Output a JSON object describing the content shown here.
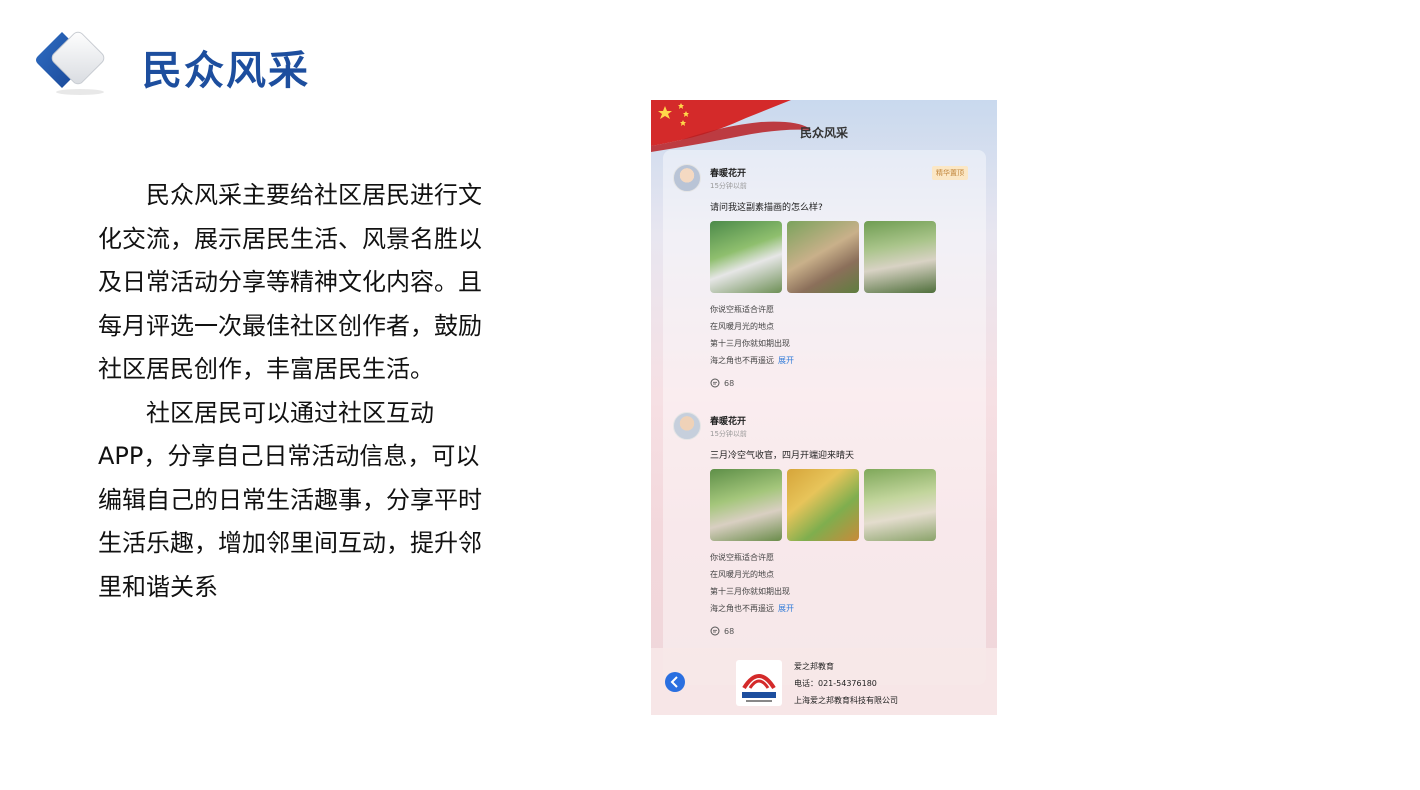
{
  "header": {
    "title": "民众风采"
  },
  "description": {
    "paragraphs": [
      "民众风采主要给社区居民进行文化交流，展示居民生活、风景名胜以及日常活动分享等精神文化内容。且每月评选一次最佳社区创作者，鼓励社区居民创作，丰富居民生活。",
      "社区居民可以通过社区互动APP，分享自己日常活动信息，可以编辑自己的日常生活趣事，分享平时生活乐趣，增加邻里间互动，提升邻里和谐关系"
    ]
  },
  "phone": {
    "title": "民众风采",
    "posts": [
      {
        "user": "春暖花开",
        "time": "15分钟以前",
        "badge": "精华置顶",
        "text": "请问我这副素描画的怎么样?",
        "lines": [
          "你说空瓶适合许愿",
          "在风暖月光的地点",
          "第十三月你就如期出现",
          "海之角也不再遥远"
        ],
        "expand": "展开",
        "comments": "68"
      },
      {
        "user": "春暖花开",
        "time": "15分钟以前",
        "text": "三月冷空气收官，四月开端迎来晴天",
        "lines": [
          "你说空瓶适合许愿",
          "在风暖月光的地点",
          "第十三月你就如期出现",
          "海之角也不再遥远"
        ],
        "expand": "展开",
        "comments": "68"
      }
    ],
    "footer": {
      "org_name": "爱之邦教育",
      "phone": "电话：021-54376180",
      "company": "上海爱之邦教育科技有限公司"
    }
  },
  "colors": {
    "title_blue": "#1d4e9e",
    "accent_blue": "#2f7ad8",
    "flag_red": "#d42a2a"
  }
}
